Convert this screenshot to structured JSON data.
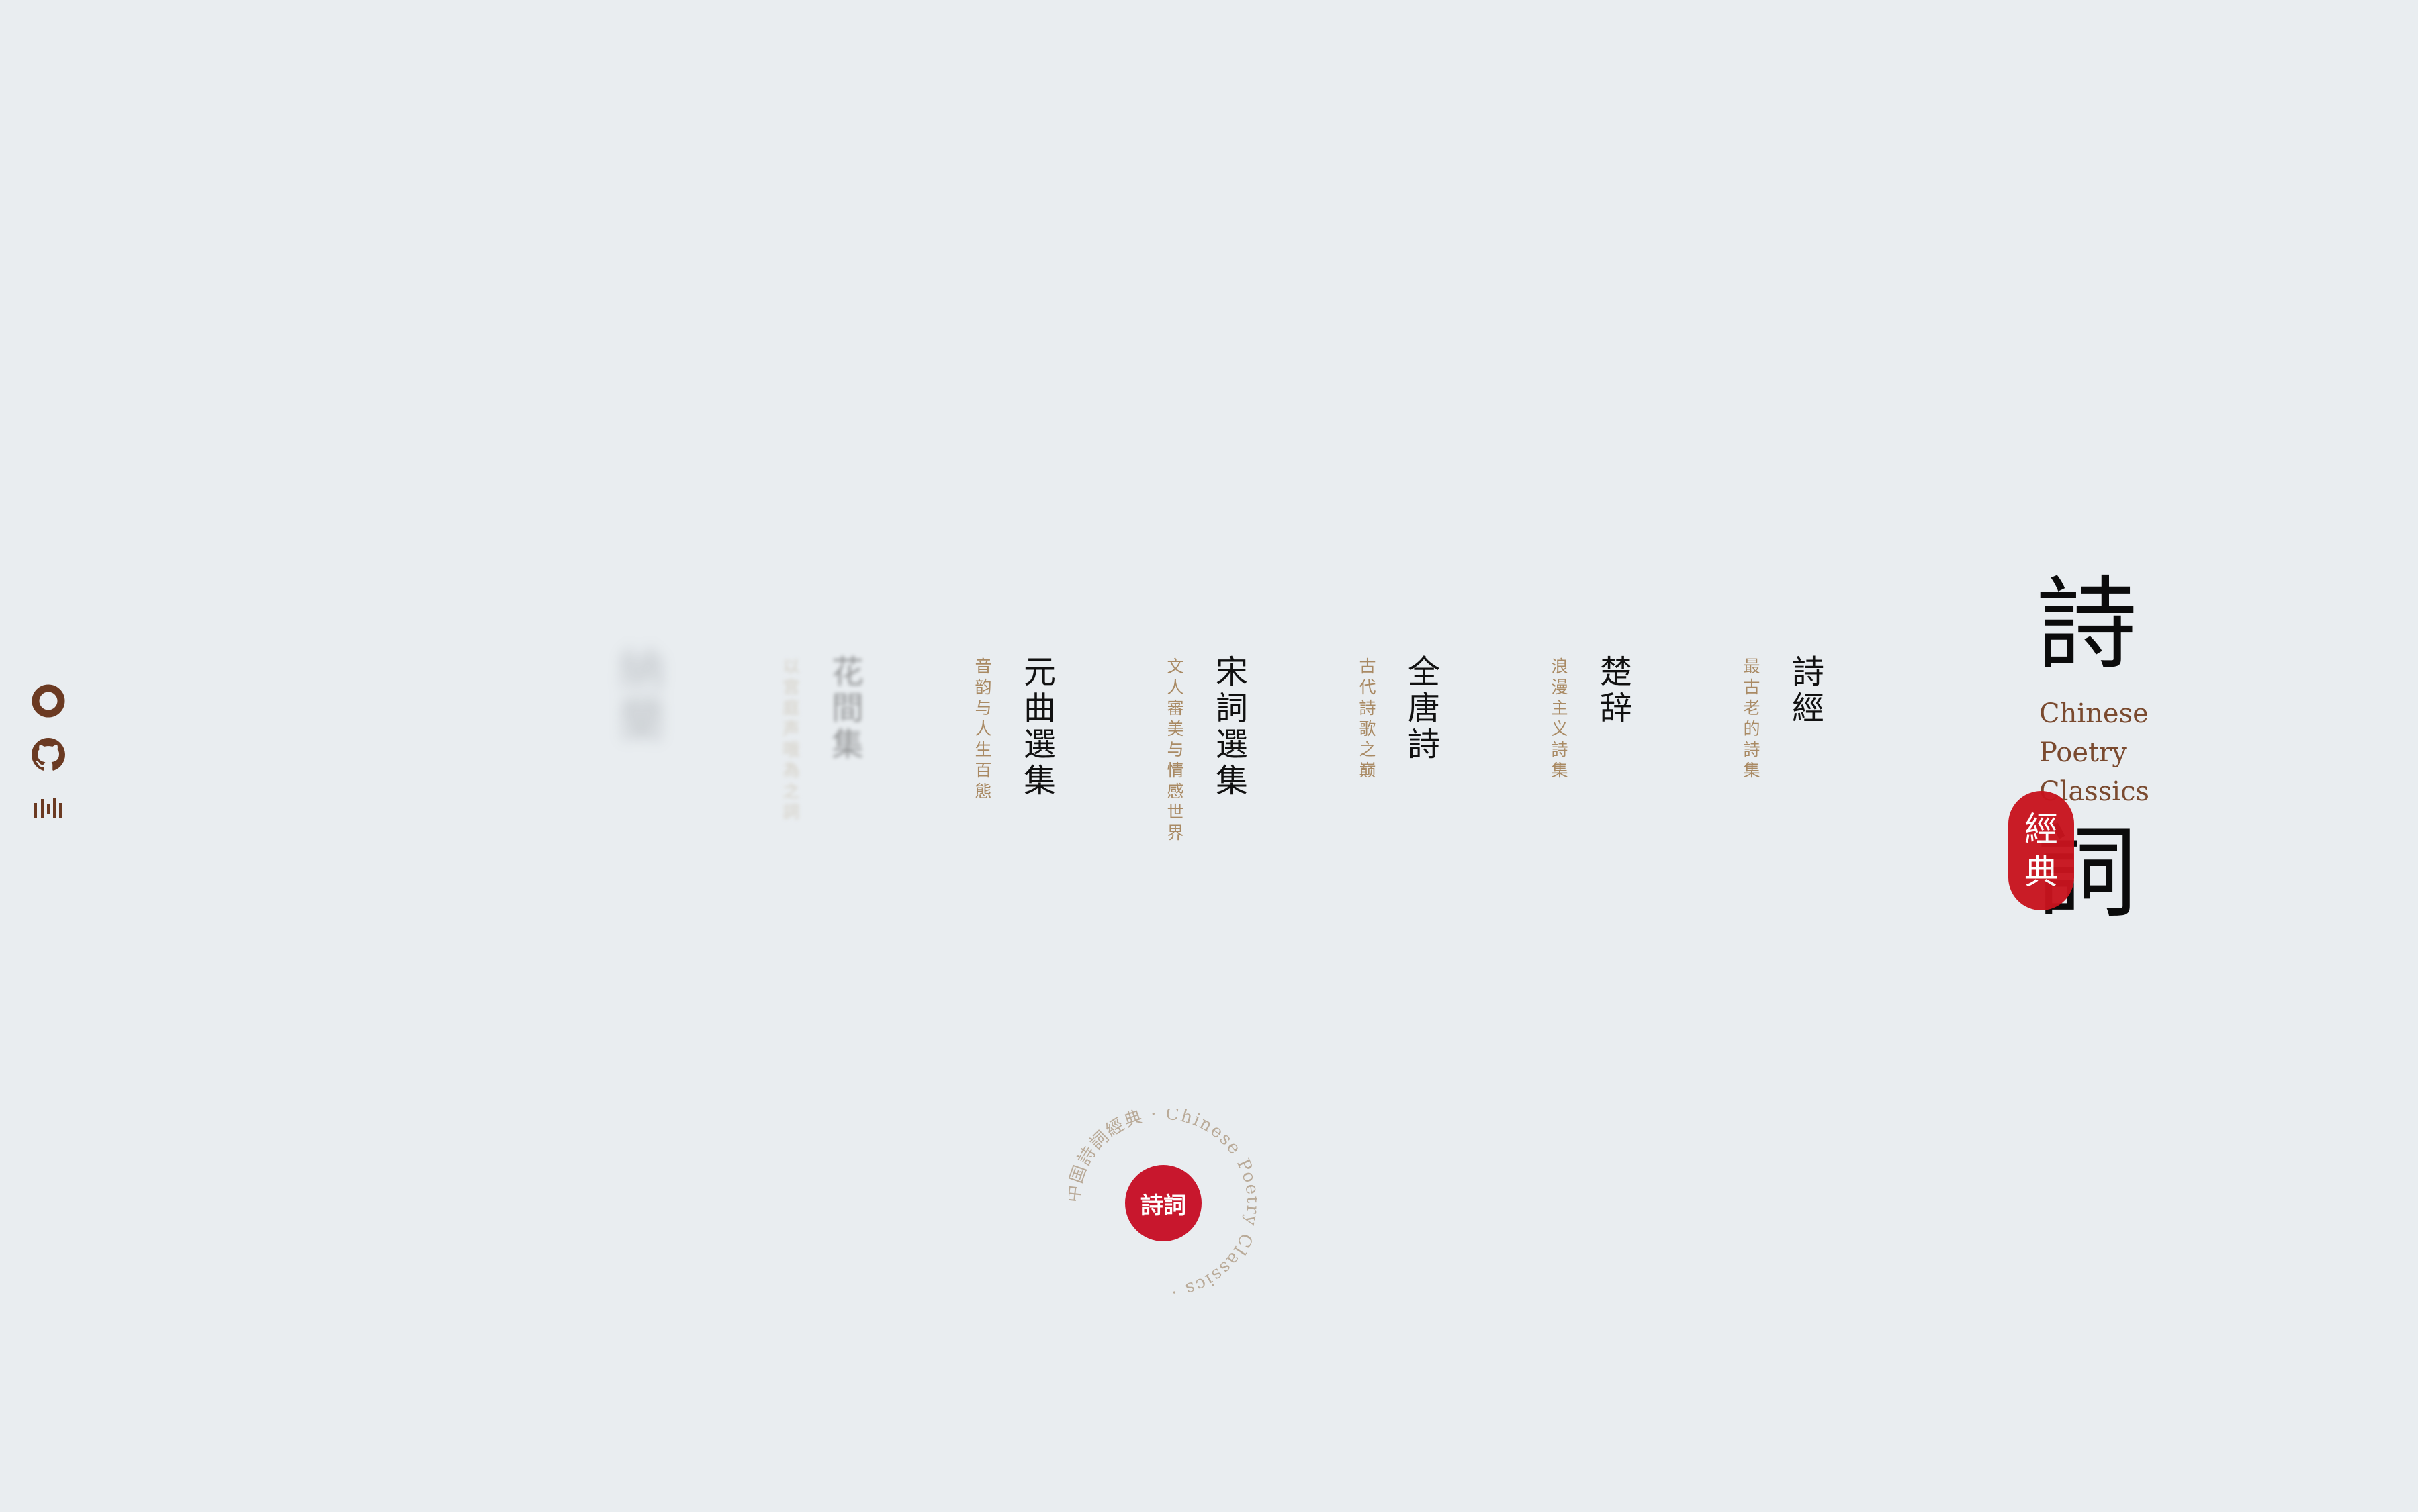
{
  "sidebar": {
    "icons": [
      {
        "name": "circle-logo-icon"
      },
      {
        "name": "github-icon"
      },
      {
        "name": "equalizer-icon"
      }
    ]
  },
  "collections": [
    {
      "title": "詩經",
      "subtitle": "最古老的詩集"
    },
    {
      "title": "楚辞",
      "subtitle": "浪漫主义詩集"
    },
    {
      "title": "全唐詩",
      "subtitle": "古代詩歌之巅"
    },
    {
      "title": "宋詞選集",
      "subtitle": "文人審美与情感世界"
    },
    {
      "title": "元曲選集",
      "subtitle": "音韵与人生百態"
    },
    {
      "title": "花間集",
      "subtitle": "以宫庭声哦為之詞"
    },
    {
      "title": "納蘭",
      "subtitle": ""
    }
  ],
  "title_block": {
    "top_char": "詩",
    "bottom_char": "詞",
    "subtitle_lines": [
      "Chinese",
      "Poetry",
      "Classics"
    ],
    "seal_chars": [
      "經",
      "典"
    ]
  },
  "stamp": {
    "ring_text": "中国詩詞經典 · Chinese Poetry Classics · ",
    "button_label": "詩詞"
  },
  "colors": {
    "background": "#e9edf0",
    "accent_red": "#c8141e",
    "brown": "#6b3a22",
    "gold": "#a98a64"
  }
}
